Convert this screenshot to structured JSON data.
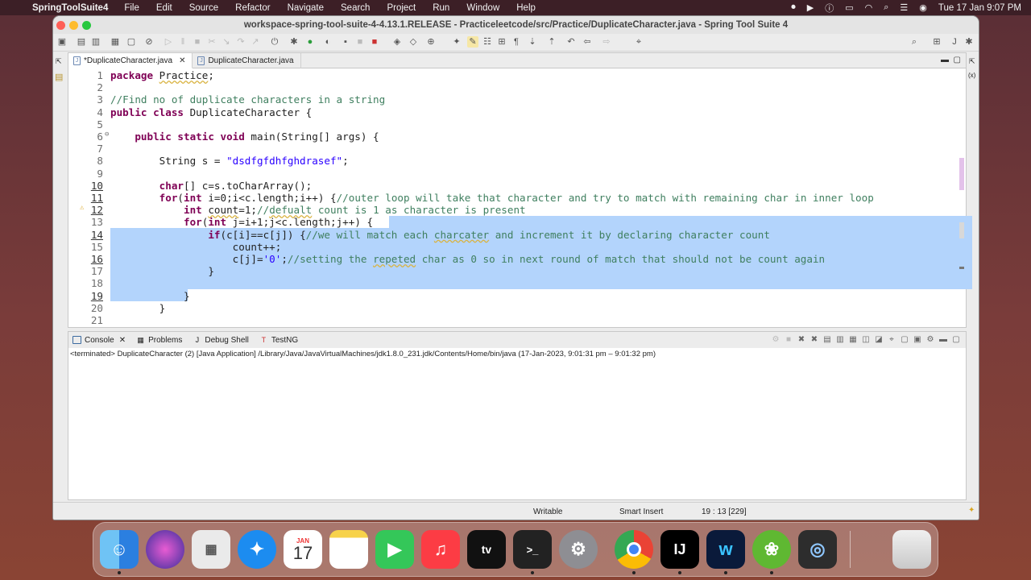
{
  "menubar": {
    "app_name": "SpringToolSuite4",
    "menus": [
      "File",
      "Edit",
      "Source",
      "Refactor",
      "Navigate",
      "Search",
      "Project",
      "Run",
      "Window",
      "Help"
    ],
    "datetime": "Tue 17 Jan  9:07 PM"
  },
  "window": {
    "title": "workspace-spring-tool-suite-4-4.13.1.RELEASE - Practiceleetcode/src/Practice/DuplicateCharacter.java - Spring Tool Suite 4"
  },
  "editor": {
    "tabs": [
      {
        "label": "*DuplicateCharacter.java",
        "active": true
      },
      {
        "label": "DuplicateCharacter.java",
        "active": false
      }
    ],
    "lines": [
      {
        "n": "1",
        "text": "package Practice;"
      },
      {
        "n": "2",
        "text": ""
      },
      {
        "n": "3",
        "text": "//Find no of duplicate characters in a string"
      },
      {
        "n": "4",
        "text": "public class DuplicateCharacter {"
      },
      {
        "n": "5",
        "text": ""
      },
      {
        "n": "6",
        "text": "    public static void main(String[] args) {"
      },
      {
        "n": "7",
        "text": ""
      },
      {
        "n": "8",
        "text": "        String s = \"dsdfgfdhfghdrasef\";"
      },
      {
        "n": "9",
        "text": ""
      },
      {
        "n": "10",
        "text": "        char[] c=s.toCharArray();"
      },
      {
        "n": "11",
        "text": "        for(int i=0;i<c.length;i++) {//outer loop will take that character and try to match with remaining char in inner loop"
      },
      {
        "n": "12",
        "text": "            int count=1;//defualt count is 1 as character is present"
      },
      {
        "n": "13",
        "text": "            for(int j=i+1;j<c.length;j++) {"
      },
      {
        "n": "14",
        "text": "                if(c[i]==c[j]) {//we will match each charcater and increment it by declaring character count"
      },
      {
        "n": "15",
        "text": "                    count++;"
      },
      {
        "n": "16",
        "text": "                    c[j]='0';//setting the repeted char as 0 so in next round of match that should not be count again"
      },
      {
        "n": "17",
        "text": "                }"
      },
      {
        "n": "18",
        "text": ""
      },
      {
        "n": "19",
        "text": "            }"
      },
      {
        "n": "20",
        "text": "        }"
      },
      {
        "n": "21",
        "text": ""
      }
    ]
  },
  "console": {
    "tabs": [
      "Console",
      "Problems",
      "Debug Shell",
      "TestNG"
    ],
    "terminated_line": "<terminated> DuplicateCharacter (2) [Java Application] /Library/Java/JavaVirtualMachines/jdk1.8.0_231.jdk/Contents/Home/bin/java  (17-Jan-2023, 9:01:31 pm – 9:01:32 pm)"
  },
  "status": {
    "writable": "Writable",
    "insert_mode": "Smart Insert",
    "position": "19 : 13 [229]"
  },
  "dock": {
    "calendar_month": "JAN",
    "calendar_day": "17",
    "apps": [
      "finder-icon",
      "siri-icon",
      "launchpad-icon",
      "safari-icon",
      "calendar-icon",
      "notes-icon",
      "facetime-icon",
      "music-icon",
      "tv-icon",
      "terminal-icon",
      "system-settings-icon",
      "chrome-icon",
      "intellij-icon",
      "webex-icon",
      "spring-tool-suite-icon",
      "preview-icon",
      "trash-icon"
    ]
  }
}
